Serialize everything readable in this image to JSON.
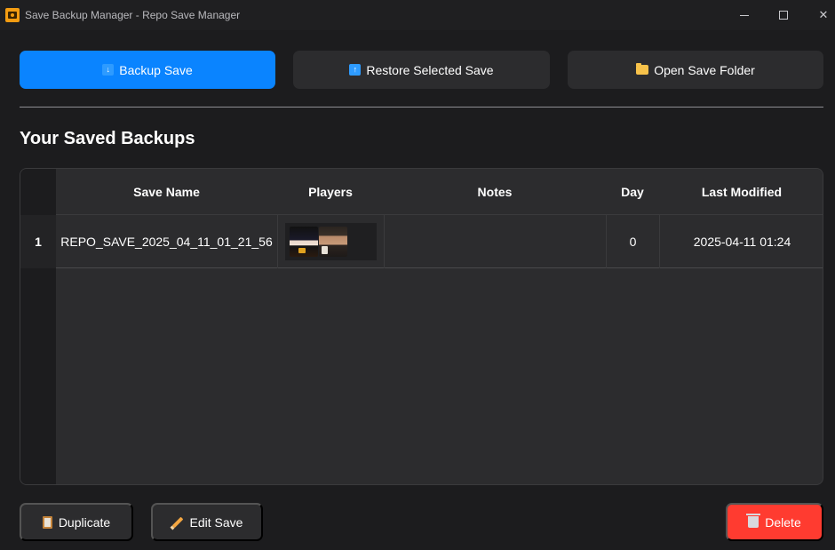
{
  "window": {
    "title": "Save Backup Manager - Repo Save Manager",
    "icon": "app-floppy-icon",
    "controls": [
      "minimize",
      "maximize",
      "close"
    ]
  },
  "toolbar": {
    "backup_label": "Backup Save",
    "backup_icon": "download-arrow-icon",
    "restore_label": "Restore Selected Save",
    "restore_icon": "upload-arrow-icon",
    "open_folder_label": "Open Save Folder",
    "open_folder_icon": "folder-icon"
  },
  "section": {
    "title": "Your Saved Backups"
  },
  "table": {
    "columns": [
      "Save Name",
      "Players",
      "Notes",
      "Day",
      "Last Modified"
    ],
    "rows": [
      {
        "index": "1",
        "save_name": "REPO_SAVE_2025_04_11_01_21_56",
        "players": [
          "player-avatar-1",
          "player-avatar-2"
        ],
        "notes": "",
        "day": "0",
        "last_modified": "2025-04-11 01:24"
      }
    ]
  },
  "actions": {
    "duplicate_label": "Duplicate",
    "duplicate_icon": "clipboard-icon",
    "edit_label": "Edit Save",
    "edit_icon": "pencil-icon",
    "delete_label": "Delete",
    "delete_icon": "trash-icon"
  },
  "colors": {
    "background": "#1c1c1e",
    "primary_button": "#0a84ff",
    "secondary_button": "#2c2c2e",
    "danger_button": "#ff3b30"
  }
}
